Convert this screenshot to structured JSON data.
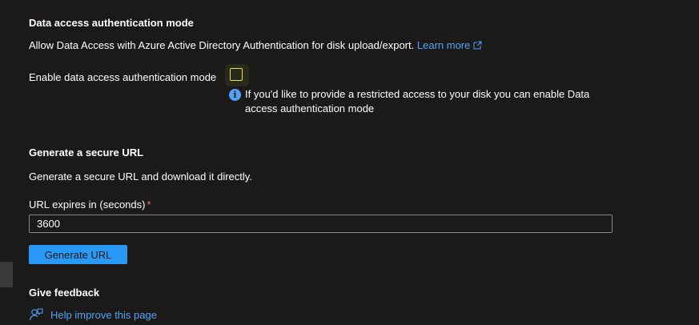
{
  "data_access": {
    "title": "Data access authentication mode",
    "description": "Allow Data Access with Azure Active Directory Authentication for disk upload/export.",
    "learn_more": "Learn more",
    "enable_label": "Enable data access authentication mode",
    "enable_checked": false,
    "info_text": "If you'd like to provide a restricted access to your disk you can enable Data access authentication mode"
  },
  "secure_url": {
    "title": "Generate a secure URL",
    "description": "Generate a secure URL and download it directly.",
    "expires_label": "URL expires in (seconds)",
    "required_marker": "*",
    "expires_value": "3600",
    "generate_button": "Generate URL"
  },
  "feedback": {
    "title": "Give feedback",
    "link_text": "Help improve this page"
  },
  "icons": {
    "external_link": "external-link-icon",
    "info": "info-icon",
    "feedback": "feedback-person-icon"
  },
  "colors": {
    "background": "#1b1a19",
    "link": "#4fa3f7",
    "primary_button": "#2899f5",
    "checkbox_border": "#e8e23a",
    "required": "#f1707b"
  }
}
